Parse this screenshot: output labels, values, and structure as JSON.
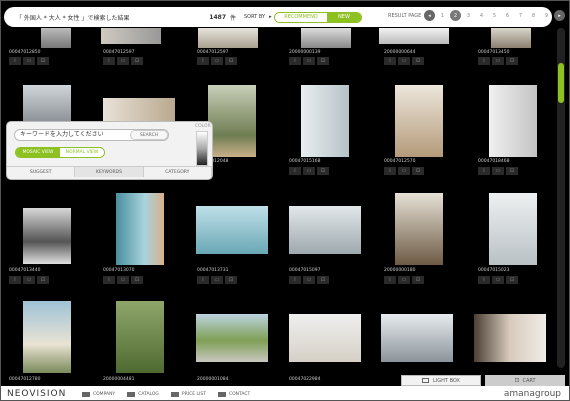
{
  "header": {
    "query": "「 外国人 * 大人 * 女性 」で検索した結果",
    "count": "1487",
    "count_unit": "件",
    "sort_label": "SORT BY",
    "sort_arrow": "▸",
    "sort_recommend": "RECOMMEND",
    "sort_new": "NEW",
    "result_page_label": "RESULT PAGE",
    "pages": [
      "1",
      "2",
      "3",
      "4",
      "5",
      "6",
      "7",
      "8",
      "9"
    ],
    "prev_icon": "◂",
    "next_icon": "▸"
  },
  "rows": [
    {
      "captions": [
        "00047012850",
        "00047012597",
        "00047012597",
        "20000000139",
        "20000000644",
        "00047013450"
      ]
    },
    {
      "captions": [
        "",
        "",
        "00047012048",
        "00047015168",
        "00047012570",
        "00047018468"
      ]
    },
    {
      "captions": [
        "00047013440",
        "00047013070",
        "00047013731",
        "00047015097",
        "20000000180",
        "00047015023"
      ]
    },
    {
      "captions": [
        "00047012780",
        "20000004481",
        "20000001084",
        "00047022984",
        "00047001046",
        "00047004442"
      ]
    }
  ],
  "panel": {
    "keyword_placeholder": "キーワードを入力してください",
    "search_btn": "SEARCH",
    "mosaic_view": "MOSAIC VIEW",
    "normal_view": "NORMAL VIEW",
    "color_label": "COLOR",
    "tabs": [
      "SUGGEST",
      "KEYWORDS",
      "CATEGORY"
    ]
  },
  "footer": {
    "logo": "NEOVISION",
    "links": [
      "COMPANY",
      "CATALOG",
      "PRICE LIST",
      "CONTACT"
    ],
    "brand": "amanagroup",
    "lightbox": "LIGHT BOX",
    "cart": "CART"
  },
  "colors": {
    "accent": "#8dc021"
  }
}
